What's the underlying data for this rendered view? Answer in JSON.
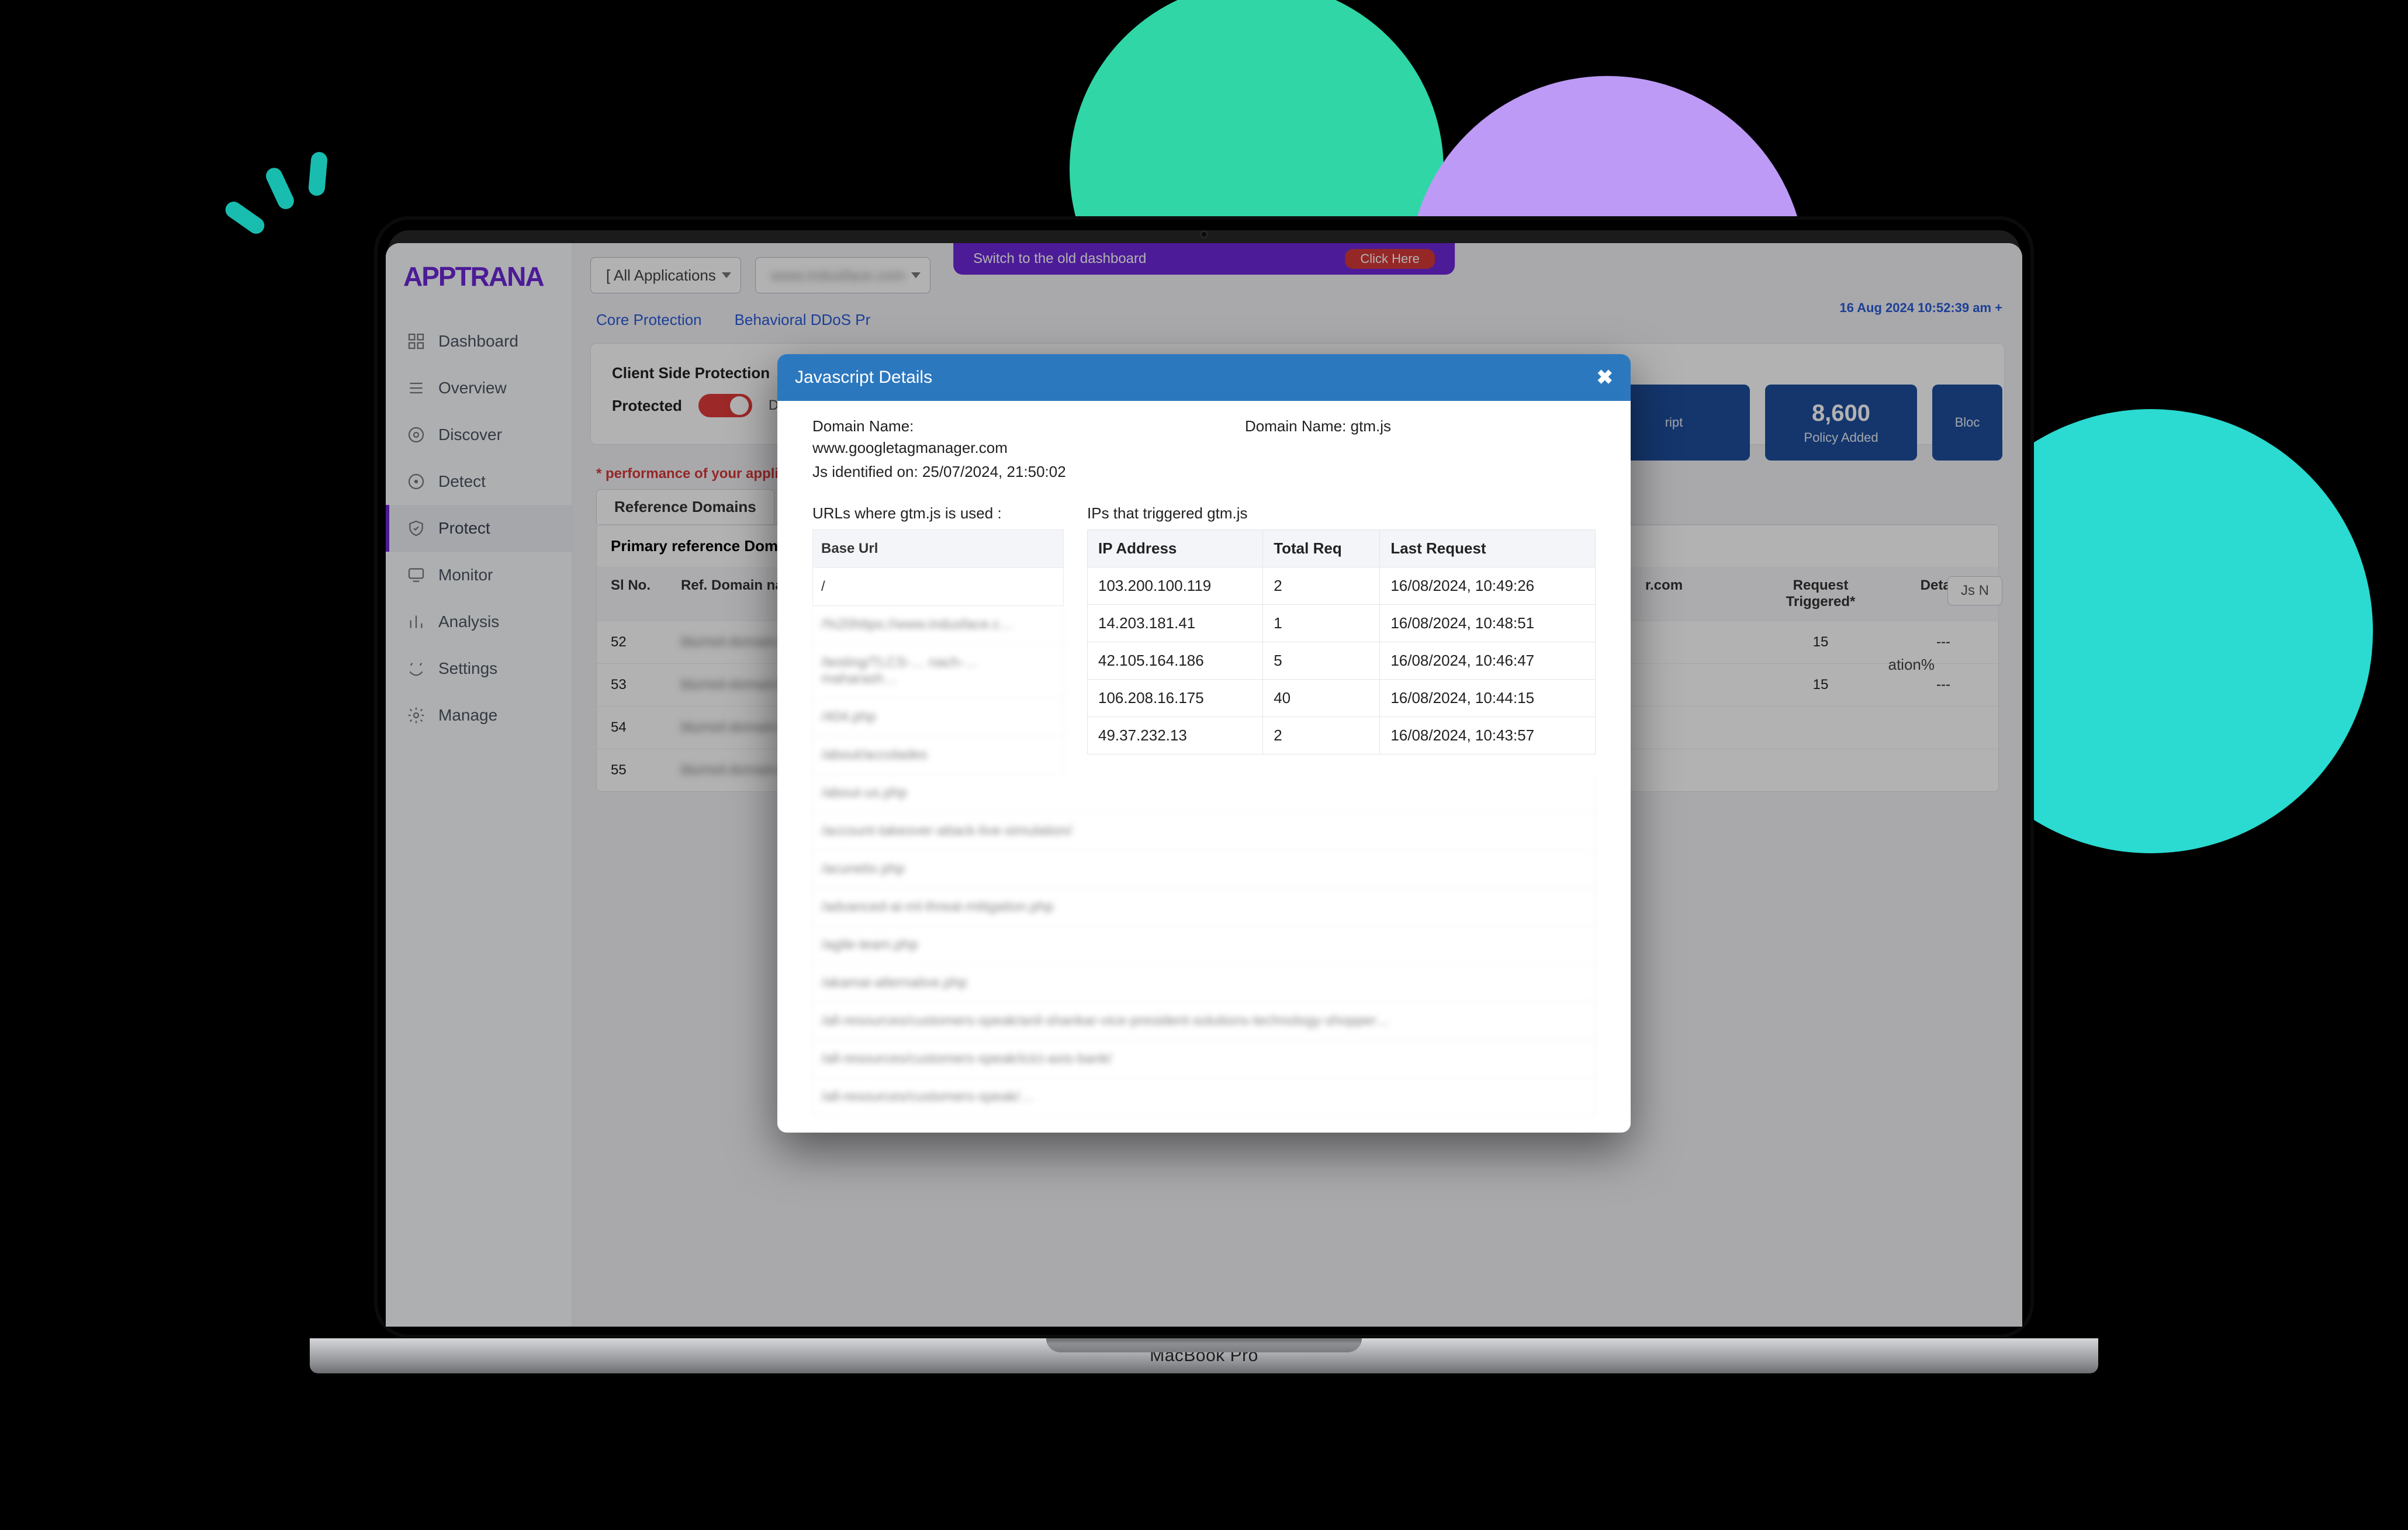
{
  "decor": {
    "laptop_label": "MacBook Pro"
  },
  "brand": "APPTRANA",
  "banner": {
    "text": "Switch to the old dashboard",
    "cta": "Click Here"
  },
  "timestamp": "16 Aug 2024 10:52:39 am +",
  "selectors": {
    "all_apps": "[ All Applications",
    "domain_blurred": "www.indusface.com"
  },
  "sidebar": [
    {
      "key": "dashboard",
      "label": "Dashboard"
    },
    {
      "key": "overview",
      "label": "Overview"
    },
    {
      "key": "discover",
      "label": "Discover"
    },
    {
      "key": "detect",
      "label": "Detect"
    },
    {
      "key": "protect",
      "label": "Protect"
    },
    {
      "key": "monitor",
      "label": "Monitor"
    },
    {
      "key": "analysis",
      "label": "Analysis"
    },
    {
      "key": "settings",
      "label": "Settings"
    },
    {
      "key": "manage",
      "label": "Manage"
    }
  ],
  "subtabs": {
    "a": "Core Protection",
    "b": "Behavioral DDoS Pr"
  },
  "panel": {
    "client_side_label": "Client Side Protection",
    "protected_label": "Protected",
    "detect_only": "Detect Only"
  },
  "stats": {
    "card1_sub": "ript",
    "card2_num": "8,600",
    "card2_sub": "Policy Added",
    "card3_sub": "Bloc"
  },
  "warning": "* performance of your application may be affected",
  "tabs": {
    "reference_domains": "Reference Domains",
    "js_btn": "Js N"
  },
  "table": {
    "section_primary": "Primary reference Domains",
    "hdr_sl": "Sl No.",
    "hdr_dom": "Ref. Domain name",
    "hdr_req": "Request Triggered*",
    "hdr_details": "Details",
    "domain_suffix": "r.com",
    "rows": [
      {
        "sl": "52",
        "dom": "blurred-domain-a",
        "req": "15",
        "det": "---"
      },
      {
        "sl": "53",
        "dom": "blurred-domain-b",
        "req": "15",
        "det": "---"
      },
      {
        "sl": "54",
        "dom": "blurred-domain-c",
        "req": "",
        "det": ""
      },
      {
        "sl": "55",
        "dom": "blurred-domain-d",
        "req": "",
        "det": ""
      }
    ]
  },
  "modal": {
    "title": "Javascript Details",
    "close": "✖",
    "domain_label": "Domain Name:",
    "domain_value": "www.googletagmanager.com",
    "file_label": "Domain Name:",
    "file_value": "gtm.js",
    "identified_label": "Js identified on:",
    "identified_value": "25/07/2024, 21:50:02",
    "urls_header": "URLs where gtm.js is used :",
    "ips_header": "IPs that triggered gtm.js",
    "url_th": "Base Url",
    "url_rows": [
      "/",
      "/%20https://www.indusface.c…",
      "/testing/TLCS-… nach-… maharash…",
      "/404.php",
      "/about/accolades",
      "/about-us.php",
      "/account-takeover-attack-live-simulation/",
      "/acunetix.php",
      "/advanced-ai-ml-threat-mitigation.php",
      "/agile-team.php",
      "/akamai-alternative.php",
      "/all-resources/customers-speak/anil-shankar-vice-president-solutions-technology-shopper…",
      "/all-resources/customers-speak/icici-axis-bank/",
      "/all-resources/customers-speak/…"
    ],
    "ip_headers": {
      "ip": "IP Address",
      "total": "Total Req",
      "last": "Last Request"
    },
    "ip_rows": [
      {
        "ip": "103.200.100.119",
        "total": "2",
        "last": "16/08/2024, 10:49:26"
      },
      {
        "ip": "14.203.181.41",
        "total": "1",
        "last": "16/08/2024, 10:48:51"
      },
      {
        "ip": "42.105.164.186",
        "total": "5",
        "last": "16/08/2024, 10:46:47"
      },
      {
        "ip": "106.208.16.175",
        "total": "40",
        "last": "16/08/2024, 10:44:15"
      },
      {
        "ip": "49.37.232.13",
        "total": "2",
        "last": "16/08/2024, 10:43:57"
      }
    ]
  }
}
